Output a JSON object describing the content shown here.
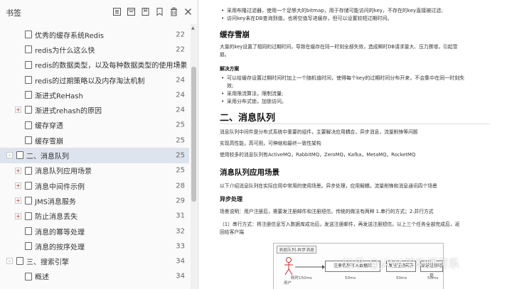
{
  "panel": {
    "title": "书签",
    "tools": [
      "expand-all-icon",
      "collapse-all-icon",
      "add-bookmark-icon",
      "bookmark-icon",
      "delete-icon",
      "close-icon"
    ],
    "items": [
      {
        "label": "优秀的缓存系统Redis",
        "page": "22",
        "level": 1,
        "expander": null,
        "selected": false
      },
      {
        "label": "redis为什么这么快",
        "page": "22",
        "level": 1,
        "expander": null,
        "selected": false
      },
      {
        "label": "redis的数据类型，以及每种数据类型的使用场景",
        "page": "23",
        "level": 1,
        "expander": null,
        "selected": false
      },
      {
        "label": "redis的过期策略以及内存淘汰机制",
        "page": "24",
        "level": 1,
        "expander": null,
        "selected": false
      },
      {
        "label": "渐进式ReHash",
        "page": "24",
        "level": 1,
        "expander": null,
        "selected": false
      },
      {
        "label": "渐进式rehash的原因",
        "page": "24",
        "level": 1,
        "expander": "+",
        "selected": false
      },
      {
        "label": "缓存穿透",
        "page": "25",
        "level": 1,
        "expander": null,
        "selected": false
      },
      {
        "label": "缓存雪崩",
        "page": "25",
        "level": 1,
        "expander": null,
        "selected": false
      },
      {
        "label": "二、消息队列",
        "page": "25",
        "level": 0,
        "expander": "-",
        "selected": true
      },
      {
        "label": "消息队列应用场景",
        "page": "25",
        "level": 1,
        "expander": "+",
        "selected": false
      },
      {
        "label": "消息中间件示例",
        "page": "28",
        "level": 1,
        "expander": "+",
        "selected": false
      },
      {
        "label": "JMS消息服务",
        "page": "29",
        "level": 1,
        "expander": "+",
        "selected": false
      },
      {
        "label": "防止消息丢失",
        "page": "31",
        "level": 1,
        "expander": "+",
        "selected": false
      },
      {
        "label": "消息的幂等处理",
        "page": "32",
        "level": 1,
        "expander": null,
        "selected": false
      },
      {
        "label": "消息的按序处理",
        "page": "33",
        "level": 1,
        "expander": null,
        "selected": false
      },
      {
        "label": "三、搜索引擎",
        "page": "34",
        "level": 0,
        "expander": "-",
        "selected": false
      },
      {
        "label": "概述",
        "page": "34",
        "level": 1,
        "expander": null,
        "selected": false
      }
    ]
  },
  "doc": {
    "top_bullets": [
      "采用布隆过滤器，使用一个足够大的bitmap，用于存储可能访问的key，不存在的key直接被过滤;",
      "访问key未在DB查询到值，也将空值写进缓存，但可以设置较短过期时间。"
    ],
    "section_avalanche_title": "缓存雪崩",
    "avalanche_para_1": "大量的key设置了相同的过期时间，导致在缓存在同一时刻全部失效，造成瞬时DB请求量大、压力骤增，引起雪",
    "avalanche_para_2": "崩。",
    "solution_title": "解决方案",
    "solution_bullets": [
      "可以给缓存设置过期时间时加上一个随机值时间，使得每个key的过期时间分布开来，不会集中在同一时刻失",
      "效;",
      "采用限流算法，限制流量;",
      "采用分布式锁，加锁访问。"
    ],
    "mq_title": "二、消息队列",
    "mq_para_1": "消息队列中间件是分布式系统中重要的组件，主要解决应用耦合，异步消息，流量削锋等问题",
    "mq_para_2": "实现高性能，高可用，可伸缩和最终一致性架构",
    "mq_para_3": "使用较多的消息队列有ActiveMQ，RabbitMQ，ZeroMQ，Kafka，MetaMQ，RocketMQ",
    "scenario_title": "消息队列应用场景",
    "scenario_para": "以下介绍消息队列在实际应用中常用的使用场景。异步处理，应用解耦，流量削锋和消息通讯四个场景",
    "async_title": "异步处理",
    "async_para": "场景说明：用户注册后，需要发注册邮件和注册短信。传统的做法有两种 1.串行的方式；2.并行方式",
    "serial_para_1": "（1）串行方式：将注册信息写入数据库成功后，发送注册邮件，再发送注册短信。以上三个任务全部完成后，返",
    "serial_para_2": "回给客户端",
    "diagram": {
      "title": "消息队列-异步消息",
      "node_1": "注册信息写入数据库",
      "node_2": "发送注册邮件",
      "node_3": "发送注册短信",
      "user": "用户",
      "t_total": "耗时150ms",
      "t_1": "50ms",
      "t_2": "50ms",
      "t_3": "50ms"
    },
    "watermark": "知乎 @JAVA架构师可乐"
  }
}
